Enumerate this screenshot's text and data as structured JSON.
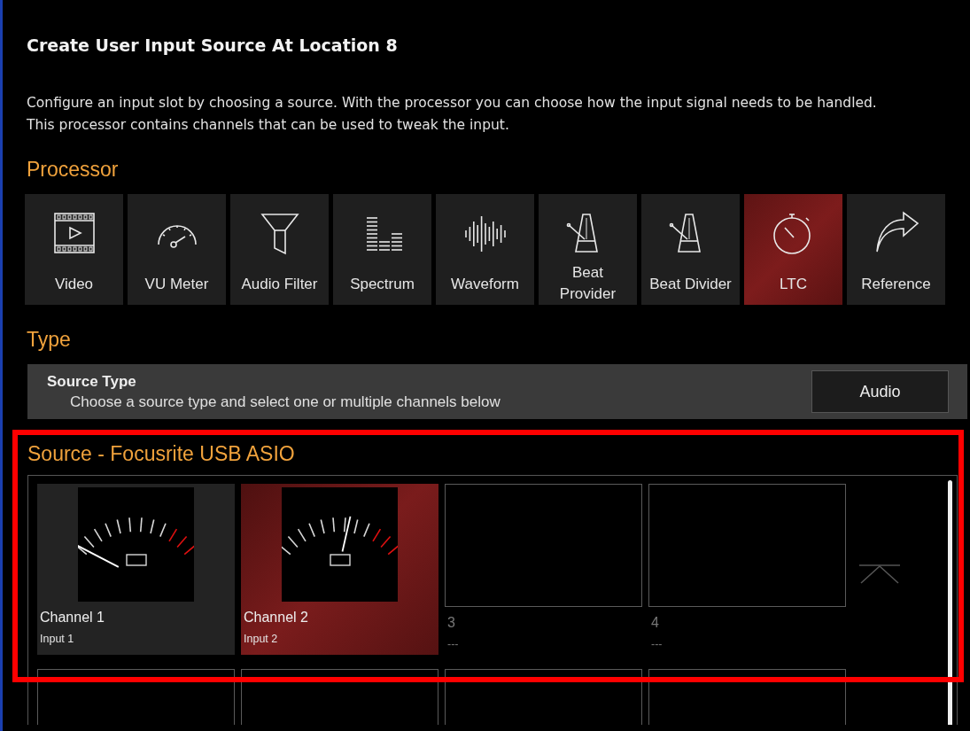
{
  "dialog": {
    "title": "Create User Input Source At Location 8",
    "description": "Configure an input slot by choosing a source. With the processor you can choose how the input signal needs to be handled. This processor contains channels that can be used to tweak the input."
  },
  "processor": {
    "heading": "Processor",
    "items": [
      {
        "label": "Video",
        "kind": "video",
        "selected": false
      },
      {
        "label": "VU Meter",
        "kind": "gauge",
        "selected": false
      },
      {
        "label": "Audio Filter",
        "kind": "funnel",
        "selected": false
      },
      {
        "label": "Spectrum",
        "kind": "bars",
        "selected": false
      },
      {
        "label": "Waveform",
        "kind": "waveform",
        "selected": false
      },
      {
        "label": "Beat Provider",
        "kind": "metronome",
        "selected": false
      },
      {
        "label": "Beat Divider",
        "kind": "metronome",
        "selected": false
      },
      {
        "label": "LTC",
        "kind": "stopwatch",
        "selected": true
      },
      {
        "label": "Reference",
        "kind": "arrow",
        "selected": false
      }
    ]
  },
  "type": {
    "heading": "Type",
    "title": "Source Type",
    "description": "Choose a source type and select one or multiple channels below",
    "button": "Audio"
  },
  "source": {
    "heading": "Source - Focusrite USB ASIO",
    "channels": [
      {
        "kind": "meter",
        "label": "Channel 1",
        "sublabel": "Input 1",
        "selected": false
      },
      {
        "kind": "meter",
        "label": "Channel 2",
        "sublabel": "Input 2",
        "selected": true
      },
      {
        "kind": "empty",
        "label": "3",
        "sublabel": "---"
      },
      {
        "kind": "empty",
        "label": "4",
        "sublabel": "---"
      },
      {
        "kind": "blank"
      },
      {
        "kind": "blank"
      },
      {
        "kind": "blank"
      },
      {
        "kind": "blank"
      }
    ]
  }
}
